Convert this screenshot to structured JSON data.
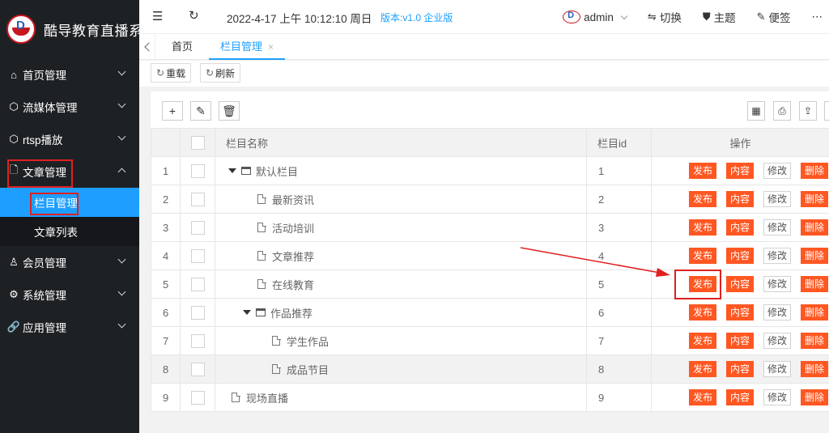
{
  "app": {
    "title": "酷导教育直播系"
  },
  "sidebar": {
    "items": [
      {
        "label": "首页管理",
        "icon": "home-icon"
      },
      {
        "label": "流媒体管理",
        "icon": "cube-icon"
      },
      {
        "label": "rtsp播放",
        "icon": "cube-icon"
      },
      {
        "label": "文章管理",
        "icon": "document-icon",
        "expanded": true
      },
      {
        "label": "会员管理",
        "icon": "users-icon"
      },
      {
        "label": "系统管理",
        "icon": "gear-icon"
      },
      {
        "label": "应用管理",
        "icon": "link-icon"
      }
    ],
    "sub_items": [
      {
        "label": "栏目管理",
        "selected": true
      },
      {
        "label": "文章列表"
      }
    ]
  },
  "topbar": {
    "datetime": "2022-4-17 上午 10:12:10 周日",
    "version": "版本:v1.0 企业版",
    "user": "admin",
    "switch_label": "切换",
    "theme_label": "主题",
    "note_label": "便签"
  },
  "tabs": [
    {
      "label": "首页"
    },
    {
      "label": "栏目管理",
      "active": true,
      "close": "×"
    }
  ],
  "actions": {
    "reload": "重载",
    "refresh": "刷新"
  },
  "table": {
    "headers": {
      "name": "栏目名称",
      "id": "栏目id",
      "ops": "操作"
    },
    "op_labels": {
      "publish": "发布",
      "content": "内容",
      "edit": "修改",
      "delete": "删除"
    },
    "rows": [
      {
        "num": "1",
        "name": "默认栏目",
        "id": "1",
        "level": 0,
        "type": "folder"
      },
      {
        "num": "2",
        "name": "最新资讯",
        "id": "2",
        "level": 1,
        "type": "file"
      },
      {
        "num": "3",
        "name": "活动培训",
        "id": "3",
        "level": 1,
        "type": "file"
      },
      {
        "num": "4",
        "name": "文章推荐",
        "id": "4",
        "level": 1,
        "type": "file"
      },
      {
        "num": "5",
        "name": "在线教育",
        "id": "5",
        "level": 1,
        "type": "file"
      },
      {
        "num": "6",
        "name": "作品推荐",
        "id": "6",
        "level": 1,
        "type": "folder"
      },
      {
        "num": "7",
        "name": "学生作品",
        "id": "7",
        "level": 2,
        "type": "file"
      },
      {
        "num": "8",
        "name": "成品节目",
        "id": "8",
        "level": 2,
        "type": "file",
        "hover": true
      },
      {
        "num": "9",
        "name": "现场直播",
        "id": "9",
        "level": 0,
        "type": "file"
      }
    ]
  },
  "colors": {
    "accent": "#1e9fff",
    "danger": "#ff5722",
    "sidebar": "#1e2124",
    "annotation": "#e02020"
  }
}
